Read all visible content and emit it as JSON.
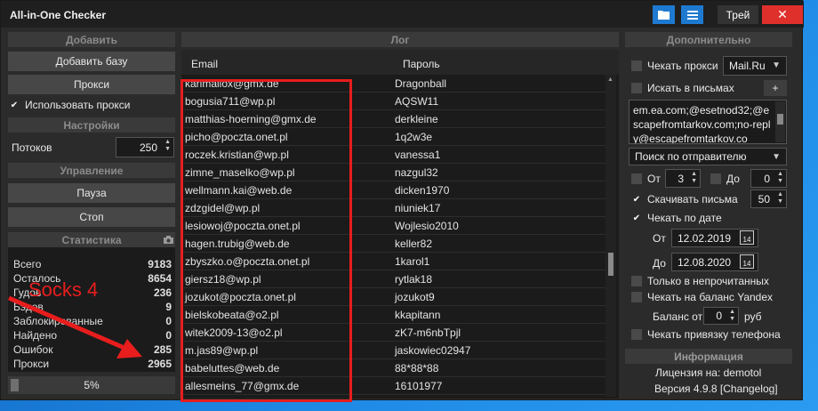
{
  "window": {
    "title": "All-in-One Checker",
    "tray_label": "Трей",
    "close_label": "✕"
  },
  "left": {
    "add_header": "Добавить",
    "add_base_button": "Добавить базу",
    "proxy_button": "Прокси",
    "use_proxy": "Использовать прокси",
    "settings_header": "Настройки",
    "threads_label": "Потоков",
    "threads_value": "250",
    "control_header": "Управление",
    "pause_button": "Пауза",
    "stop_button": "Стоп",
    "stats_header": "Статистика",
    "stats": [
      {
        "label": "Всего",
        "value": "9183"
      },
      {
        "label": "Осталось",
        "value": "8654"
      },
      {
        "label": "Гудов",
        "value": "236"
      },
      {
        "label": "Бэдов",
        "value": "9"
      },
      {
        "label": "Заблокированные",
        "value": "0"
      },
      {
        "label": "Найдено",
        "value": "0"
      },
      {
        "label": "Ошибок",
        "value": "285"
      },
      {
        "label": "Прокси",
        "value": "2965"
      }
    ],
    "progress_text": "5%",
    "progress_value": 0.05
  },
  "log": {
    "header": "Лог",
    "col_email": "Email",
    "col_password": "Пароль",
    "rows": [
      {
        "email": "karimallox@gmx.de",
        "password": "Dragonball"
      },
      {
        "email": "bogusia711@wp.pl",
        "password": "AQSW11"
      },
      {
        "email": "matthias-hoerning@gmx.de",
        "password": "derkleine"
      },
      {
        "email": "picho@poczta.onet.pl",
        "password": "1q2w3e"
      },
      {
        "email": "roczek.kristian@wp.pl",
        "password": "vanessa1"
      },
      {
        "email": "zimne_maselko@wp.pl",
        "password": "nazgul32"
      },
      {
        "email": "wellmann.kai@web.de",
        "password": "dicken1970"
      },
      {
        "email": "zdzgidel@wp.pl",
        "password": "niuniek17"
      },
      {
        "email": "lesiowoj@poczta.onet.pl",
        "password": "Wojlesio2010"
      },
      {
        "email": "hagen.trubig@web.de",
        "password": "keller82"
      },
      {
        "email": "zbyszko.o@poczta.onet.pl",
        "password": "1karol1"
      },
      {
        "email": "giersz18@wp.pl",
        "password": "rytlak18"
      },
      {
        "email": "jozukot@poczta.onet.pl",
        "password": "jozukot9"
      },
      {
        "email": "bielskobeata@o2.pl",
        "password": "kkapitann"
      },
      {
        "email": "witek2009-13@o2.pl",
        "password": "zK7-m6nbTpjl"
      },
      {
        "email": "m.jas89@wp.pl",
        "password": "jaskowiec02947"
      },
      {
        "email": "babeluttes@web.de",
        "password": "88*88*88"
      },
      {
        "email": "allesmeins_77@gmx.de",
        "password": "16101977"
      }
    ]
  },
  "right": {
    "extra_header": "Дополнительно",
    "check_proxy": "Чекать прокси",
    "service_select": "Mail.Ru",
    "search_in_letters": "Искать в письмах",
    "plus_label": "+",
    "search_text": "em.ea.com;@esetnod32;@escapefromtarkov.com;no-reply@escapefromtarkov.co",
    "search_by_select": "Поиск по отправителю",
    "from_label": "От",
    "from_value": "3",
    "to_label": "До",
    "to_value": "0",
    "download_letters": "Скачивать письма",
    "download_value": "50",
    "check_by_date": "Чекать по дате",
    "date_from_label": "От",
    "date_from": "12.02.2019",
    "date_to_label": "До",
    "date_to": "12.08.2020",
    "only_unread": "Только в непрочитанных",
    "check_yandex_balance": "Чекать на баланс Yandex",
    "balance_from_label": "Баланс от",
    "balance_value": "0",
    "balance_unit": "руб",
    "check_phone": "Чекать привязку телефона",
    "info_header": "Информация",
    "license": "Лицензия на: demotol",
    "version": "Версия 4.9.8 [Changelog]"
  },
  "annotation": {
    "text": "Socks 4",
    "color": "#e81d1d"
  }
}
